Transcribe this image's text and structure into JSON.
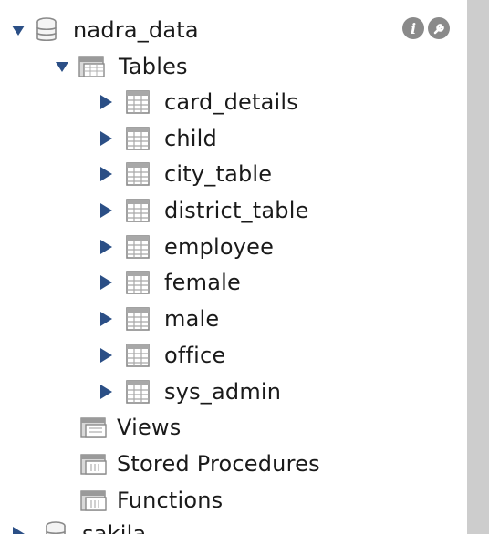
{
  "schema_tree": {
    "schemas": [
      {
        "name": "nadra_data",
        "expanded": true,
        "sections": {
          "tables": {
            "label": "Tables",
            "expanded": true,
            "items": [
              "card_details",
              "child",
              "city_table",
              "district_table",
              "employee",
              "female",
              "male",
              "office",
              "sys_admin"
            ]
          },
          "views": {
            "label": "Views"
          },
          "stored_procedures": {
            "label": "Stored Procedures"
          },
          "functions": {
            "label": "Functions"
          }
        }
      },
      {
        "name": "sakila",
        "expanded": false
      }
    ]
  },
  "icons": {
    "schema": "database-icon",
    "folder": "folder-icon",
    "table": "table-icon",
    "info": "info-icon",
    "inspect": "wrench-icon"
  },
  "colors": {
    "arrow": "#2b4f86",
    "icon_gray": "#8a8a8a",
    "scrollbar": "#cdcdcd"
  }
}
